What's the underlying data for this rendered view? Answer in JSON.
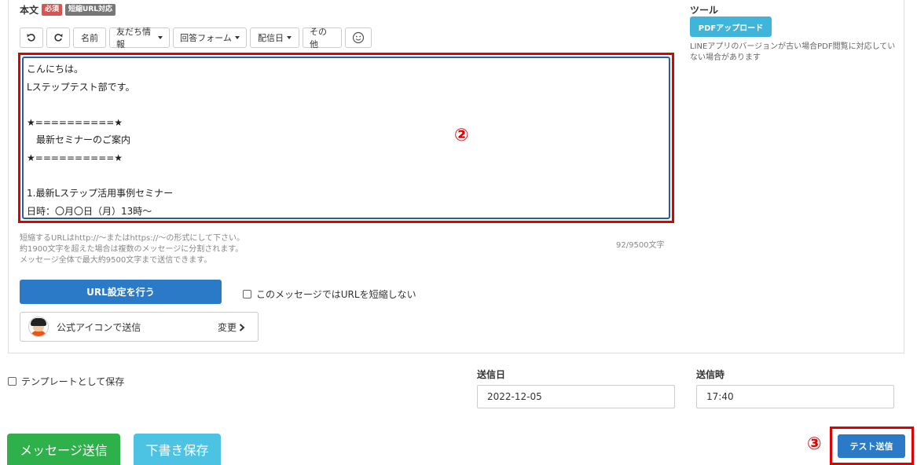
{
  "body_label": "本文",
  "badges": {
    "required": "必須",
    "short_url": "短縮URL対応"
  },
  "toolbar": {
    "undo_icon": "undo-icon",
    "redo_icon": "redo-icon",
    "name": "名前",
    "friend_info": "友だち情報",
    "answer_form": "回答フォーム",
    "delivery_date": "配信日",
    "other": "その他",
    "emoji_icon": "smiley-icon"
  },
  "editor_lines": [
    "こんにちは。",
    "Lステップテスト部です。",
    "",
    "★==========★",
    "　最新セミナーのご案内",
    "★==========★",
    "",
    "1.最新Lステップ活用事例セミナー",
    "日時：〇月〇日（月）13時〜"
  ],
  "annotation_2": "②",
  "annotation_3": "③",
  "helper_lines": [
    "短縮するURLはhttp://〜またはhttps://〜の形式にして下さい。",
    "約1900文字を超えた場合は複数のメッセージに分割されます。",
    "メッセージ全体で最大約9500文字まで送信できます。"
  ],
  "char_count": "92/9500文字",
  "url_button": "URL設定を行う",
  "no_shorten_label": "このメッセージではURLを短縮しない",
  "sender": {
    "label": "公式アイコンで送信",
    "change": "変更"
  },
  "tools": {
    "title": "ツール",
    "pdf_upload": "PDFアップロード",
    "pdf_note": "LINEアプリのバージョンが古い場合PDF閲覧に対応していない場合があります"
  },
  "template_save_label": "テンプレートとして保存",
  "send_date": {
    "label": "送信日",
    "value": "2022-12-05"
  },
  "send_time": {
    "label": "送信時",
    "value": "17:40"
  },
  "buttons": {
    "send_message": "メッセージ送信",
    "save_draft": "下書き保存",
    "test_send": "テスト送信"
  },
  "colors": {
    "primary": "#2a7ac7",
    "success": "#2eb14a",
    "info": "#4dc3e3",
    "annotation": "#e00000"
  }
}
